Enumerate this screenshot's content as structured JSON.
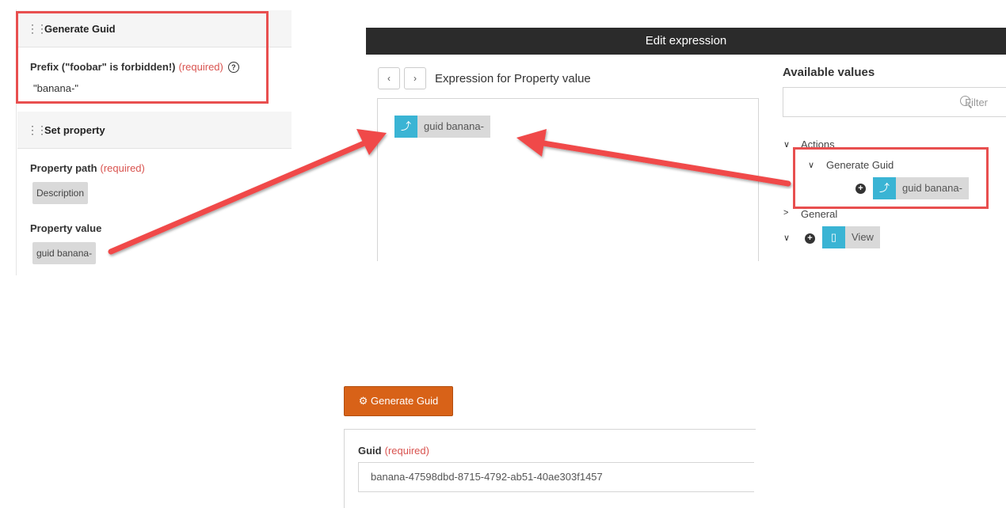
{
  "left_panel": {
    "step1": {
      "title": "Generate Guid",
      "prefix_label": "Prefix (\"foobar\" is forbidden!)",
      "prefix_required": "(required)",
      "prefix_value": "\"banana-\""
    },
    "step2": {
      "title": "Set property",
      "path_label": "Property path",
      "path_required": "(required)",
      "path_value": "Description",
      "value_label": "Property value",
      "value_value": "guid banana-"
    }
  },
  "dialog": {
    "title": "Edit expression",
    "back_icon": "‹",
    "forward_icon": "›",
    "expression_title": "Expression for Property value",
    "expression_token": "guid banana-",
    "available_title": "Available values",
    "filter_placeholder": "Filter",
    "tree": {
      "actions": "Actions",
      "generate_guid": "Generate Guid",
      "guid_token": "guid banana-",
      "general": "General",
      "view": "View"
    }
  },
  "form": {
    "button_label": "Generate Guid",
    "guid_label": "Guid",
    "guid_required": "(required)",
    "guid_value": "banana-47598dbd-8715-4792-ab51-40ae303f1457"
  },
  "colors": {
    "red_highlight": "#e84f4f",
    "token_blue": "#3ab4d4",
    "button_orange": "#d86218",
    "required_red": "#d9534f"
  }
}
